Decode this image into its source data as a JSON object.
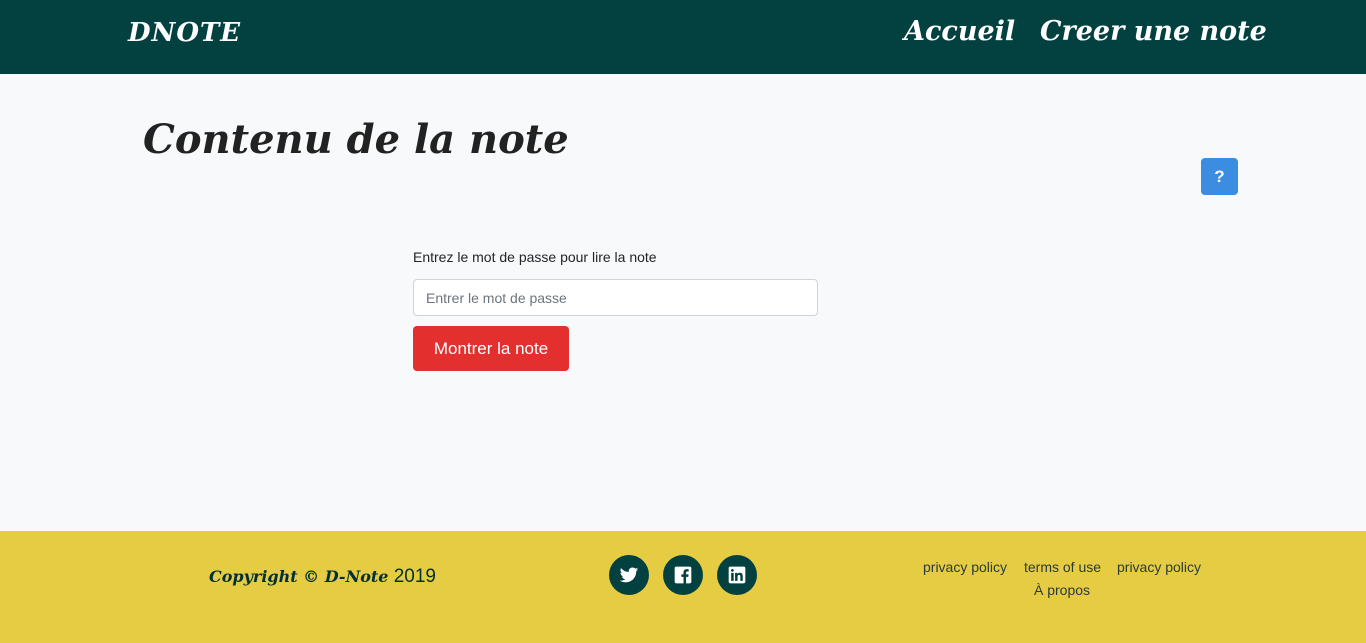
{
  "navbar": {
    "brand": "DNOTE",
    "links": [
      {
        "label": "Accueil"
      },
      {
        "label": "Creer une note"
      }
    ],
    "background_color": "#024140"
  },
  "main": {
    "title": "Contenu de la note",
    "help_button_label": "?",
    "form": {
      "label": "Entrez le mot de passe pour lire la note",
      "password_placeholder": "Entrer le mot de passe",
      "password_value": "",
      "submit_label": "Montrer la note"
    }
  },
  "footer": {
    "copyright_prefix": "Copyright © D-Note",
    "copyright_year": "2019",
    "social": [
      {
        "icon": "twitter-icon"
      },
      {
        "icon": "facebook-icon"
      },
      {
        "icon": "linkedin-icon"
      }
    ],
    "links": [
      "privacy policy",
      "terms of use",
      "privacy policy",
      "À propos"
    ],
    "background_color": "#e5cc43"
  },
  "colors": {
    "accent_red": "#e3302f",
    "help_blue": "#3a8de0"
  }
}
